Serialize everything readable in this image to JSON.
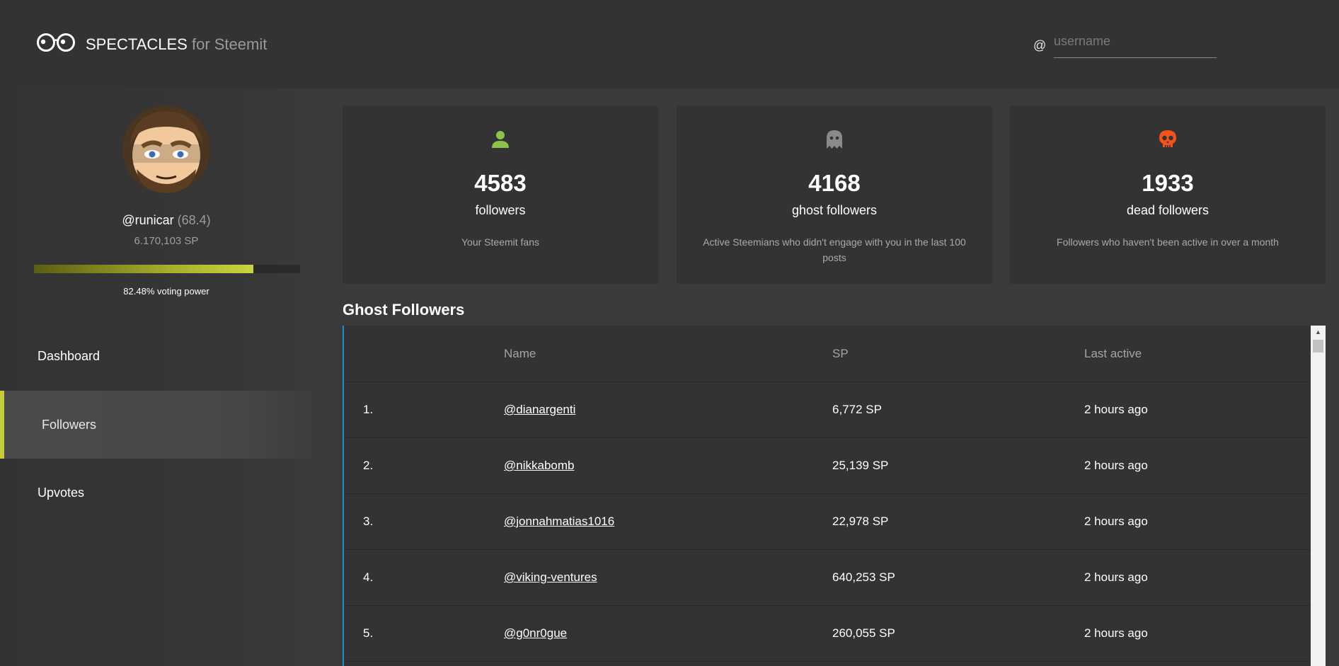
{
  "header": {
    "brand_main": "SPECTACLES",
    "brand_sub": " for Steemit",
    "at_symbol": "@",
    "search_placeholder": "username"
  },
  "profile": {
    "username": "@runicar",
    "reputation": "(68.4)",
    "sp": "6.170,103 SP",
    "voting_power_fraction": 0.8248,
    "voting_power_label": "82.48% voting power"
  },
  "nav": [
    {
      "label": "Dashboard",
      "active": false
    },
    {
      "label": "Followers",
      "active": true
    },
    {
      "label": "Upvotes",
      "active": false
    }
  ],
  "stats": [
    {
      "icon": "person-icon",
      "color": "#8bc34a",
      "number": "4583",
      "label": "followers",
      "desc": "Your Steemit fans"
    },
    {
      "icon": "ghost-icon",
      "color": "#8a8a8a",
      "number": "4168",
      "label": "ghost followers",
      "desc": "Active Steemians who didn't engage with you in the last 100 posts"
    },
    {
      "icon": "skull-icon",
      "color": "#f4511e",
      "number": "1933",
      "label": "dead followers",
      "desc": "Followers who haven't been active in over a month"
    }
  ],
  "ghost_followers": {
    "title": "Ghost Followers",
    "columns": [
      "Name",
      "SP",
      "Last active"
    ],
    "rows": [
      {
        "index": "1.",
        "name": "@dianargenti",
        "sp": "6,772 SP",
        "last_active": "2 hours ago"
      },
      {
        "index": "2.",
        "name": "@nikkabomb",
        "sp": "25,139 SP",
        "last_active": "2 hours ago"
      },
      {
        "index": "3.",
        "name": "@jonnahmatias1016",
        "sp": "22,978 SP",
        "last_active": "2 hours ago"
      },
      {
        "index": "4.",
        "name": "@viking-ventures",
        "sp": "640,253 SP",
        "last_active": "2 hours ago"
      },
      {
        "index": "5.",
        "name": "@g0nr0gue",
        "sp": "260,055 SP",
        "last_active": "2 hours ago"
      }
    ]
  },
  "colors": {
    "accent": "#c3cc3a",
    "table_border": "#1f8fd1"
  }
}
